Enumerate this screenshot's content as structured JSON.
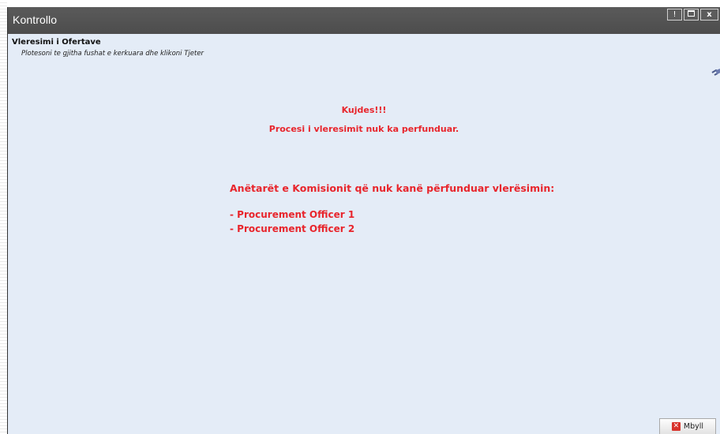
{
  "window": {
    "title": "Kontrollo",
    "buttons": [
      {
        "name": "help",
        "label": "!"
      },
      {
        "name": "maximize",
        "icon": "maximize-icon"
      },
      {
        "name": "close",
        "label": "x"
      }
    ]
  },
  "header": {
    "title": "Vleresimi i Ofertave",
    "subtitle": "Plotesoni te gjitha fushat e kerkuara dhe klikoni Tjeter",
    "icon": "plug-icon"
  },
  "message": {
    "warning_title": "Kujdes!!!",
    "warning_text": "Procesi i vleresimit nuk ka perfunduar.",
    "members_heading": "Anëtarët e Komisionit që nuk kanë përfunduar vlerësimin:",
    "members": [
      "- Procurement Officer 1",
      "- Procurement Officer 2"
    ]
  },
  "footer": {
    "close_label": "Mbyll",
    "close_icon": "close-x-icon"
  },
  "colors": {
    "warning_red": "#e8252c",
    "titlebar": "#525252",
    "background": "#e4ecf7"
  }
}
